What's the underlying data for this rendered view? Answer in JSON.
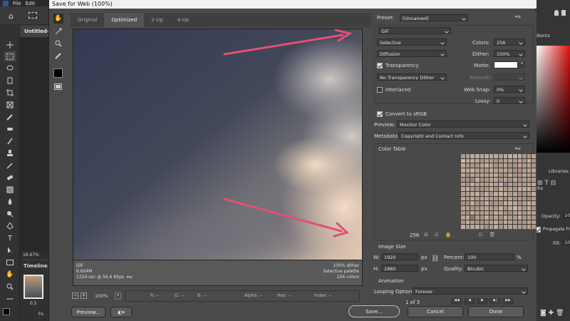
{
  "ps": {
    "menu": [
      "File",
      "Edit"
    ],
    "doc_tab": "Untitled-",
    "zoom": "16.67%",
    "timeline": "Timeline",
    "frame_time": "0.5",
    "right_tabs": [
      "adients",
      "Libraries",
      "aths"
    ],
    "opacity_label": "Opacity:",
    "opacity_value": "10",
    "propagate": "Propagate Fr",
    "fill_label": "Fill:",
    "fill_value": "10",
    "foo": "Fo"
  },
  "dialog": {
    "title": "Save for Web (100%)",
    "tabs": [
      "Original",
      "Optimized",
      "2-Up",
      "4-Up"
    ],
    "info_left": [
      "GIF",
      "6.604M",
      "1224 sec @ 56.6 Kbps"
    ],
    "info_right": [
      "100% dither",
      "Selective palette",
      "256 colors"
    ],
    "zoom": "100%",
    "status": {
      "r": "R: --",
      "g": "G: --",
      "b": "B: --",
      "alpha": "Alpha: --",
      "hex": "Hex: --",
      "index": "Index: --"
    },
    "buttons": {
      "preview": "Preview...",
      "save": "Save...",
      "cancel": "Cancel",
      "done": "Done"
    }
  },
  "settings": {
    "preset_label": "Preset:",
    "preset_value": "[Unnamed]",
    "format": "GIF",
    "reduction": "Selective",
    "dither_algo": "Diffusion",
    "colors_label": "Colors:",
    "colors_value": "256",
    "dither_label": "Dither:",
    "dither_value": "100%",
    "transparency": "Transparency",
    "matte_label": "Matte:",
    "trans_dither": "No Transparency Dither",
    "amount_label": "Amount:",
    "interlaced": "Interlaced",
    "websnap_label": "Web Snap:",
    "websnap_value": "0%",
    "lossy_label": "Lossy:",
    "lossy_value": "0",
    "convert_srgb": "Convert to sRGB",
    "preview_label": "Preview:",
    "preview_value": "Monitor Color",
    "metadata_label": "Metadata:",
    "metadata_value": "Copyright and Contact Info",
    "color_table": "Color Table",
    "color_count": "256",
    "image_size": "Image Size",
    "w_label": "W:",
    "w_value": "1920",
    "h_label": "H:",
    "h_value": "2880",
    "px": "px",
    "percent_label": "Percent:",
    "percent_value": "100",
    "pct": "%",
    "quality_label": "Quality:",
    "quality_value": "Bicubic",
    "animation": "Animation",
    "looping_label": "Looping Options:",
    "looping_value": "Forever",
    "frame_count": "1 of 3"
  },
  "colors": {
    "arrow": "#e05272",
    "accent": "#ffffff"
  }
}
